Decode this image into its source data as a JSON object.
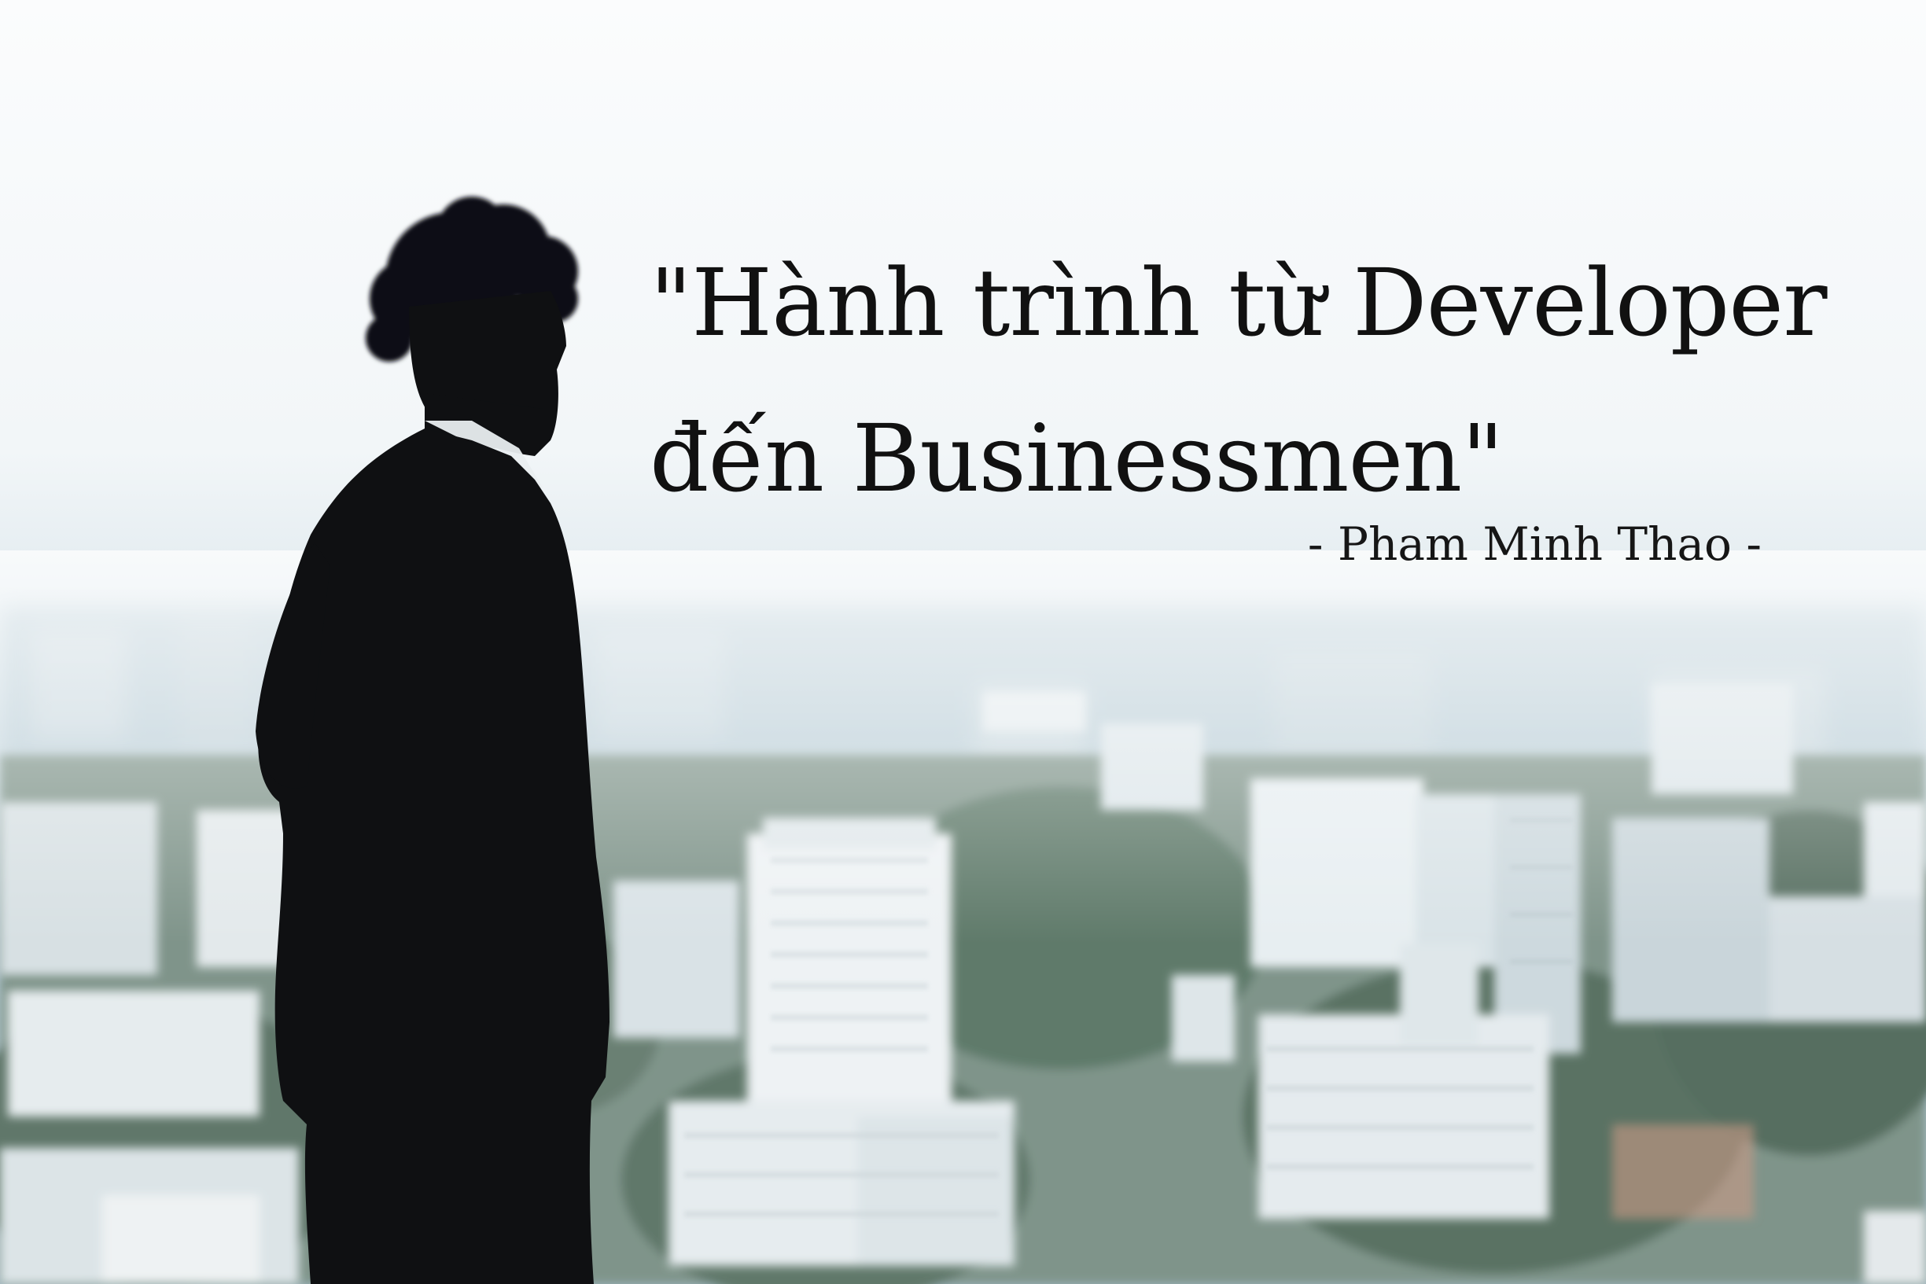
{
  "quote": {
    "line1": "\"Hành trình từ Developer",
    "line2": "đến Businessmen\""
  },
  "author": "- Pham Minh Thao -",
  "colors": {
    "sky_top": "#f7fafb",
    "sky_horizon": "#c9dbe3",
    "haze": "#a9c0cc",
    "buildings_light": "#e8eef0",
    "buildings_mid": "#b9c8cf",
    "trees": "#5d7468",
    "silhouette": "#0f1012",
    "text": "#111111"
  },
  "icons": {
    "figure": "man-silhouette",
    "background": "city-skyline"
  }
}
